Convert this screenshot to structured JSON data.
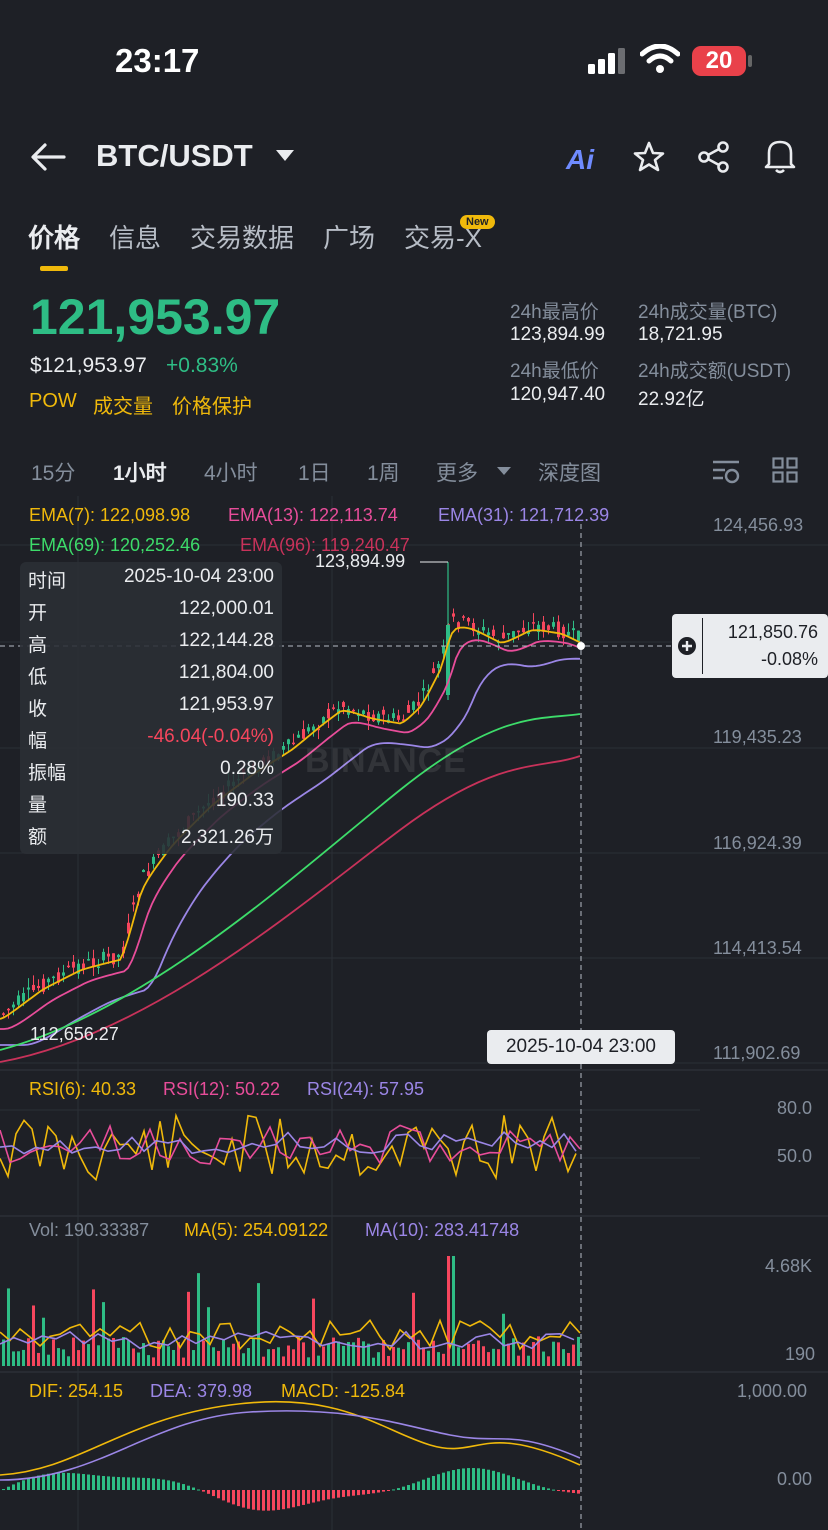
{
  "status_bar": {
    "time": "23:17",
    "battery": "20"
  },
  "header": {
    "pair": "BTC/USDT",
    "ai_label": "Ai"
  },
  "tabs": [
    {
      "label": "价格",
      "active": true
    },
    {
      "label": "信息"
    },
    {
      "label": "交易数据"
    },
    {
      "label": "广场"
    },
    {
      "label": "交易-X"
    }
  ],
  "new_badge": "New",
  "price": {
    "last": "121,953.97",
    "usd": "$121,953.97",
    "change": "+0.83%",
    "tags": [
      "POW",
      "成交量",
      "价格保护"
    ]
  },
  "stats": {
    "high_label": "24h最高价",
    "high": "123,894.99",
    "low_label": "24h最低价",
    "low": "120,947.40",
    "vol_btc_label": "24h成交量(BTC)",
    "vol_btc": "18,721.95",
    "vol_usdt_label": "24h成交额(USDT)",
    "vol_usdt": "22.92亿"
  },
  "intervals": [
    "15分",
    "1小时",
    "4小时",
    "1日",
    "1周",
    "更多",
    "深度图"
  ],
  "active_interval": "1小时",
  "ema": {
    "ema7": "EMA(7): 122,098.98",
    "ema13": "EMA(13): 122,113.74",
    "ema31": "EMA(31): 121,712.39",
    "ema69": "EMA(69): 120,252.46",
    "ema96": "EMA(96): 119,240.47"
  },
  "price_axis": [
    "124,456.93",
    "119,435.23",
    "116,924.39",
    "114,413.54",
    "111,902.69"
  ],
  "crosshair": {
    "price": "121,850.76",
    "change": "-0.08%",
    "time": "2025-10-04 23:00"
  },
  "high_marker": "123,894.99",
  "low_marker": "112,656.27",
  "watermark": "BINANCE",
  "tooltip": {
    "rows": [
      {
        "k": "时间",
        "v": "2025-10-04 23:00"
      },
      {
        "k": "开",
        "v": "122,000.01"
      },
      {
        "k": "高",
        "v": "122,144.28"
      },
      {
        "k": "低",
        "v": "121,804.00"
      },
      {
        "k": "收",
        "v": "121,953.97"
      },
      {
        "k": "幅",
        "v": "-46.04(-0.04%)"
      },
      {
        "k": "振幅",
        "v": "0.28%"
      },
      {
        "k": "量",
        "v": "190.33"
      },
      {
        "k": "额",
        "v": "2,321.26万"
      }
    ]
  },
  "rsi": {
    "rsi6": "RSI(6): 40.33",
    "rsi12": "RSI(12): 50.22",
    "rsi24": "RSI(24): 57.95",
    "axis": [
      "80.0",
      "50.0"
    ]
  },
  "volume": {
    "vol": "Vol: 190.33387",
    "ma5": "MA(5): 254.09122",
    "ma10": "MA(10): 283.41748",
    "axis": [
      "4.68K",
      "190"
    ]
  },
  "macd": {
    "dif": "DIF: 254.15",
    "dea": "DEA: 379.98",
    "macd": "MACD: -125.84",
    "axis": [
      "1,000.00",
      "0.00"
    ]
  },
  "colors": {
    "up": "#2ebd85",
    "down": "#f6465d",
    "accent": "#f0b90b",
    "ema7": "#f0b90b",
    "ema13": "#e84d9a",
    "ema31": "#9b86e6",
    "ema69": "#3ddc6a",
    "ema96": "#c8325a"
  }
}
